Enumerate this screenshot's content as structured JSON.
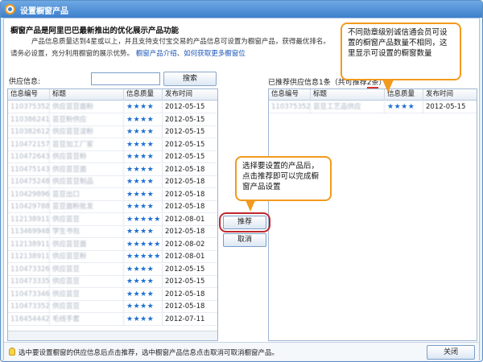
{
  "window": {
    "title": "设置橱窗产品"
  },
  "intro": {
    "heading": "橱窗产品是阿里巴巴最新推出的优化展示产品功能",
    "line1": "产品信息质量达到4星或以上，并且支持支付宝交易的产品信息可设置为橱窗产品，获得最优排名。",
    "line2": "请务必设置，充分利用橱窗的展示优势。",
    "link1": "橱窗产品介绍",
    "sep": "、",
    "link2": "如何获取更多橱窗位"
  },
  "search": {
    "label": "供应信息:",
    "value": "",
    "button": "搜索"
  },
  "recommended": {
    "label_prefix": "已推荐供应信息1条（共可推荐",
    "label_limit": "2条",
    "label_suffix": "）"
  },
  "columns": {
    "id": "信息编号",
    "title": "标题",
    "quality": "信息质量",
    "date": "发布时间"
  },
  "left_rows": [
    {
      "id": "1103753526",
      "title": "供应芸豆面粉",
      "stars": "★★★★",
      "date": "2012-05-15"
    },
    {
      "id": "1103862416",
      "title": "芸豆粉供应",
      "stars": "★★★★",
      "date": "2012-05-15"
    },
    {
      "id": "1103826121",
      "title": "供应芸豆淀粉",
      "stars": "★★★★",
      "date": "2012-05-15"
    },
    {
      "id": "1104721574",
      "title": "芸豆加工厂家",
      "stars": "★★★★",
      "date": "2012-05-15"
    },
    {
      "id": "1104726432",
      "title": "供应芸豆粉",
      "stars": "★★★★",
      "date": "2012-05-15"
    },
    {
      "id": "1104751436",
      "title": "供应芸豆面",
      "stars": "★★★★",
      "date": "2012-05-18"
    },
    {
      "id": "1104752485",
      "title": "供应芸豆制品",
      "stars": "★★★★",
      "date": "2012-05-18"
    },
    {
      "id": "1104298965",
      "title": "芸豆出口",
      "stars": "★★★★",
      "date": "2012-05-18"
    },
    {
      "id": "1104297883",
      "title": "芸豆面粉批发",
      "stars": "★★★★",
      "date": "2012-05-18"
    },
    {
      "id": "1121389111",
      "title": "供应芸豆",
      "stars": "★★★★★",
      "date": "2012-08-01"
    },
    {
      "id": "1134699485",
      "title": "学生书包",
      "stars": "★★★★",
      "date": "2012-05-18"
    },
    {
      "id": "1121389112",
      "title": "供应芸豆面",
      "stars": "★★★★★",
      "date": "2012-08-02"
    },
    {
      "id": "1121389113",
      "title": "供应芸豆粉",
      "stars": "★★★★★",
      "date": "2012-08-01"
    },
    {
      "id": "1104733263",
      "title": "供应芸豆",
      "stars": "★★★★",
      "date": "2012-05-15"
    },
    {
      "id": "1104733358",
      "title": "供应芸豆",
      "stars": "★★★★",
      "date": "2012-05-15"
    },
    {
      "id": "1104733466",
      "title": "供应芸豆",
      "stars": "★★★★",
      "date": "2012-05-18"
    },
    {
      "id": "1104733521",
      "title": "供应芸豆",
      "stars": "★★★★",
      "date": "2012-05-18"
    },
    {
      "id": "1164544429",
      "title": "毛线手套",
      "stars": "★★★★",
      "date": "2012-07-11"
    }
  ],
  "right_rows": [
    {
      "id": "1103753528",
      "title": "芸豆工艺品供应",
      "stars": "★★★★",
      "date": "2012-05-15"
    }
  ],
  "buttons": {
    "recommend": "推荐",
    "cancel": "取消",
    "close": "关闭"
  },
  "callouts": {
    "a": "不同勋章级别诚信通会员可设置的橱窗产品数量不相同，这里显示可设置的橱窗数量",
    "b": "选择要设置的产品后，点击推荐即可以完成橱窗产品设置"
  },
  "footer": {
    "tip": "选中要设置橱窗的供应信息后点击推荐，选中橱窗产品信息点击取消可取消橱窗产品。"
  },
  "colors": {
    "accent": "#f29a1d",
    "stars": "#1f6fd0",
    "highlight": "#c0282b",
    "link": "#1a55b8"
  }
}
